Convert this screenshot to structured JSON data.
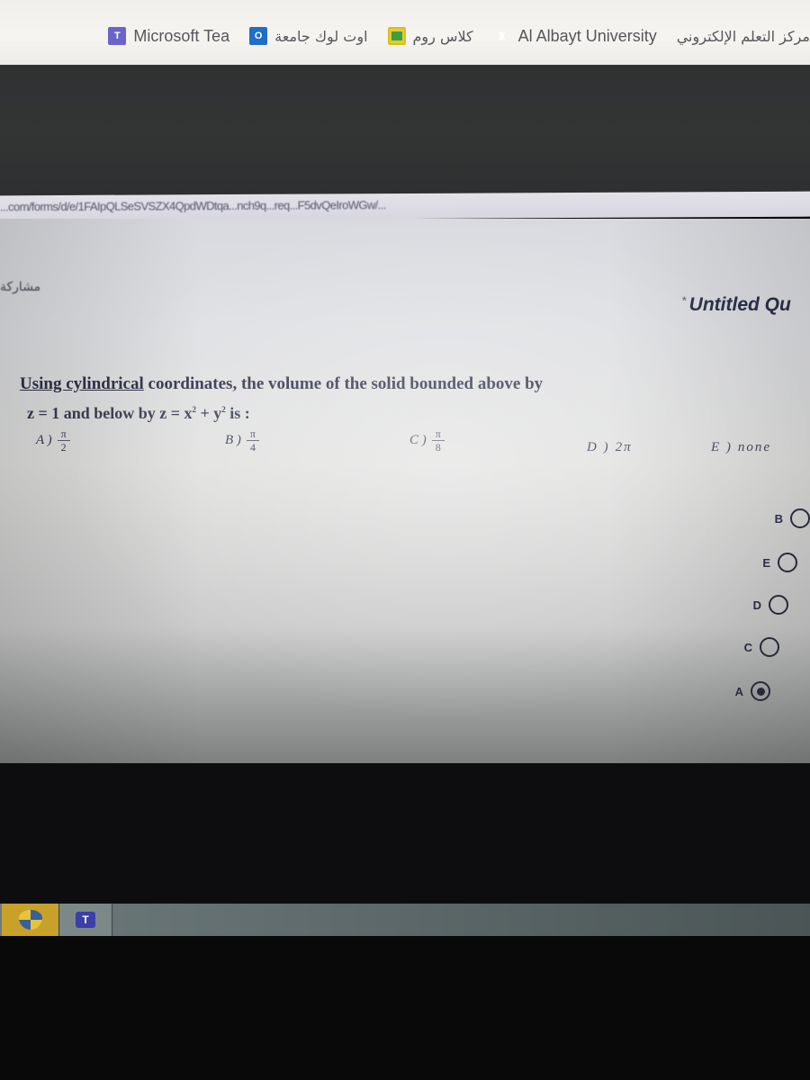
{
  "bookmarks": [
    {
      "label": "مركز التعلم الإلكتروني",
      "icon": "none"
    },
    {
      "label": "Al Albayt University",
      "icon": "university-icon"
    },
    {
      "label": "كلاس روم",
      "icon": "classroom-icon"
    },
    {
      "label": "اوت لوك جامعة",
      "icon": "outlook-icon"
    },
    {
      "label": "Microsoft Tea",
      "icon": "teams-icon"
    }
  ],
  "address_bar": {
    "url_fragment": "...com/forms/d/e/1FAIpQLSeSVSZX4QpdWDtqa...nch9q...req...F5dvQeIroWGw/..."
  },
  "page": {
    "share_label": "مشاركة",
    "form_title": "Untitled Qu",
    "required_mark": "*",
    "question": {
      "line1_underlined": "Using cylindrical",
      "line1_rest": " coordinates, the volume of the solid bounded above by",
      "line2_a": "z = 1 and below by z = x",
      "line2_b": " + y",
      "line2_c": " is :",
      "exponent": "2"
    },
    "options": [
      {
        "letter": "A )",
        "numerator": "π",
        "denominator": "2"
      },
      {
        "letter": "B )",
        "numerator": "π",
        "denominator": "4"
      },
      {
        "letter": "C )",
        "numerator": "π",
        "denominator": "8"
      },
      {
        "letter": "D )",
        "text": "2π"
      },
      {
        "letter": "E )",
        "text": "none"
      }
    ],
    "choices": [
      {
        "letter": "B",
        "selected": false
      },
      {
        "letter": "E",
        "selected": false
      },
      {
        "letter": "D",
        "selected": false
      },
      {
        "letter": "C",
        "selected": false
      },
      {
        "letter": "A",
        "selected": true
      }
    ]
  },
  "taskbar": {
    "items": [
      {
        "name": "security-app",
        "icon": "shield-icon"
      },
      {
        "name": "microsoft-teams",
        "icon": "teams-icon",
        "label": "T"
      }
    ]
  }
}
